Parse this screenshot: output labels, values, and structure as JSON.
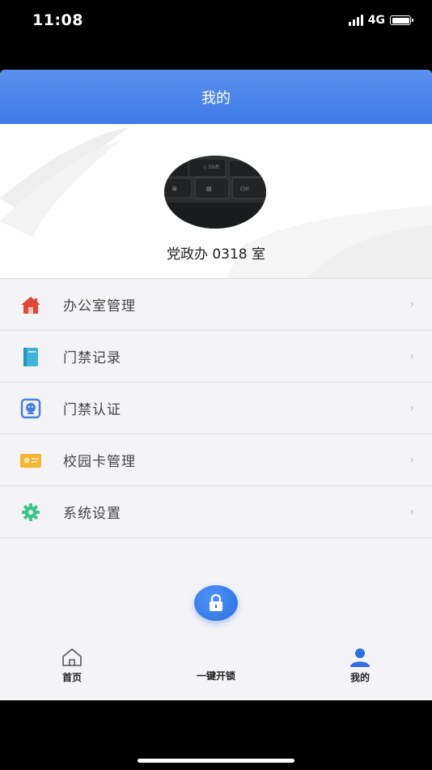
{
  "status_bar": {
    "time": "11:08",
    "network": "4G"
  },
  "header": {
    "title": "我的"
  },
  "profile": {
    "name": "党政办 0318 室"
  },
  "menu": {
    "items": [
      {
        "label": "办公室管理",
        "icon": "house-icon",
        "color": "#e0473c"
      },
      {
        "label": "门禁记录",
        "icon": "book-icon",
        "color": "#3fb3d8"
      },
      {
        "label": "门禁认证",
        "icon": "face-id-icon",
        "color": "#4a7fe0"
      },
      {
        "label": "校园卡管理",
        "icon": "id-card-icon",
        "color": "#f2b634"
      },
      {
        "label": "系统设置",
        "icon": "gear-icon",
        "color": "#3fc38f"
      }
    ],
    "chevron": "›"
  },
  "tab_bar": {
    "home": "首页",
    "unlock": "一键开锁",
    "mine": "我的",
    "active_color": "#2f6fe0"
  }
}
